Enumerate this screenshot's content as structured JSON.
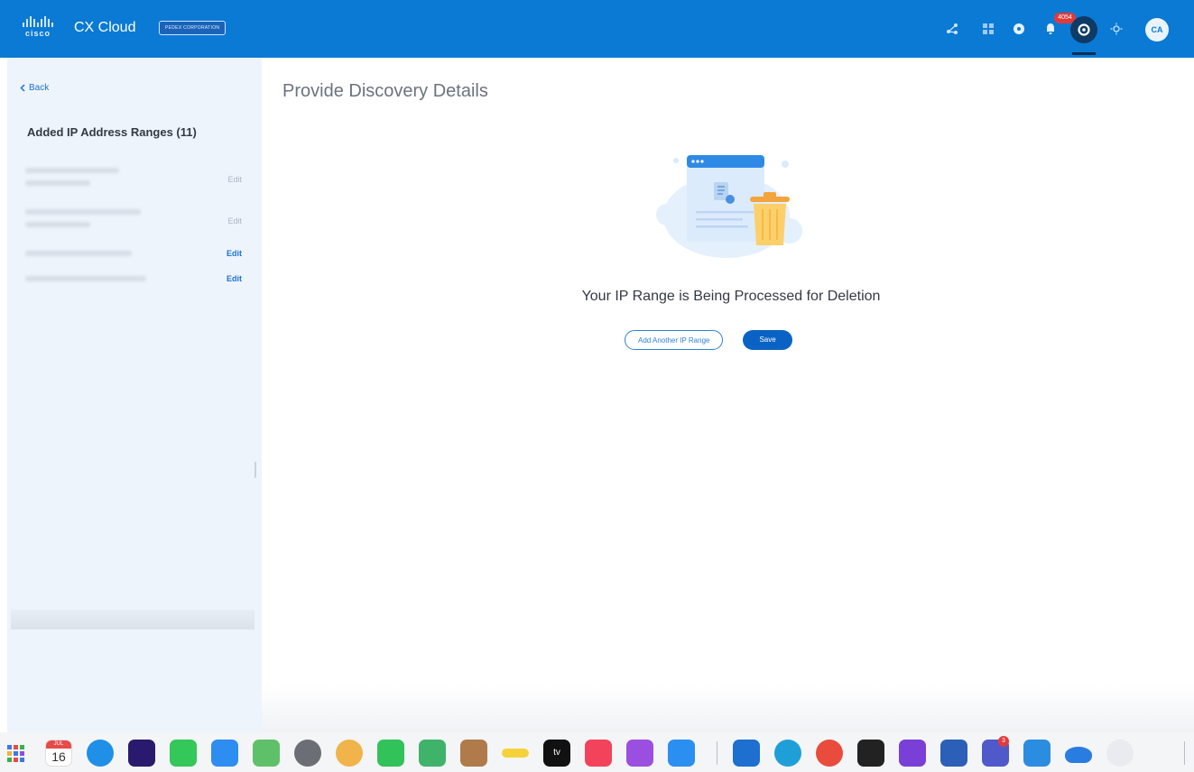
{
  "header": {
    "logo_text": "cisco",
    "app_title": "CX Cloud",
    "org_badge": "PEDEX CORPORATION",
    "notification_count": "4054",
    "avatar_initials": "CA"
  },
  "sidebar": {
    "back_label": "Back",
    "title": "Added IP Address Ranges (11)",
    "ranges": [
      {
        "edit_label": "Edit",
        "edit_active": false
      },
      {
        "edit_label": "Edit",
        "edit_active": false
      },
      {
        "edit_label": "Edit",
        "edit_active": true
      },
      {
        "edit_label": "Edit",
        "edit_active": true
      }
    ]
  },
  "main": {
    "page_title": "Provide Discovery Details",
    "message": "Your IP Range is Being Processed for Deletion",
    "add_button_label": "Add Another IP Range",
    "save_button_label": "Save"
  },
  "dock": {
    "calendar_day": "16",
    "calendar_month": "JUL",
    "appletv_label": "tv",
    "teams_badge": "3"
  },
  "colors": {
    "header_bg": "#0a7ad4",
    "primary": "#0a63c4",
    "sidebar_bg": "#eef4fb",
    "badge_red": "#e23a3a"
  }
}
